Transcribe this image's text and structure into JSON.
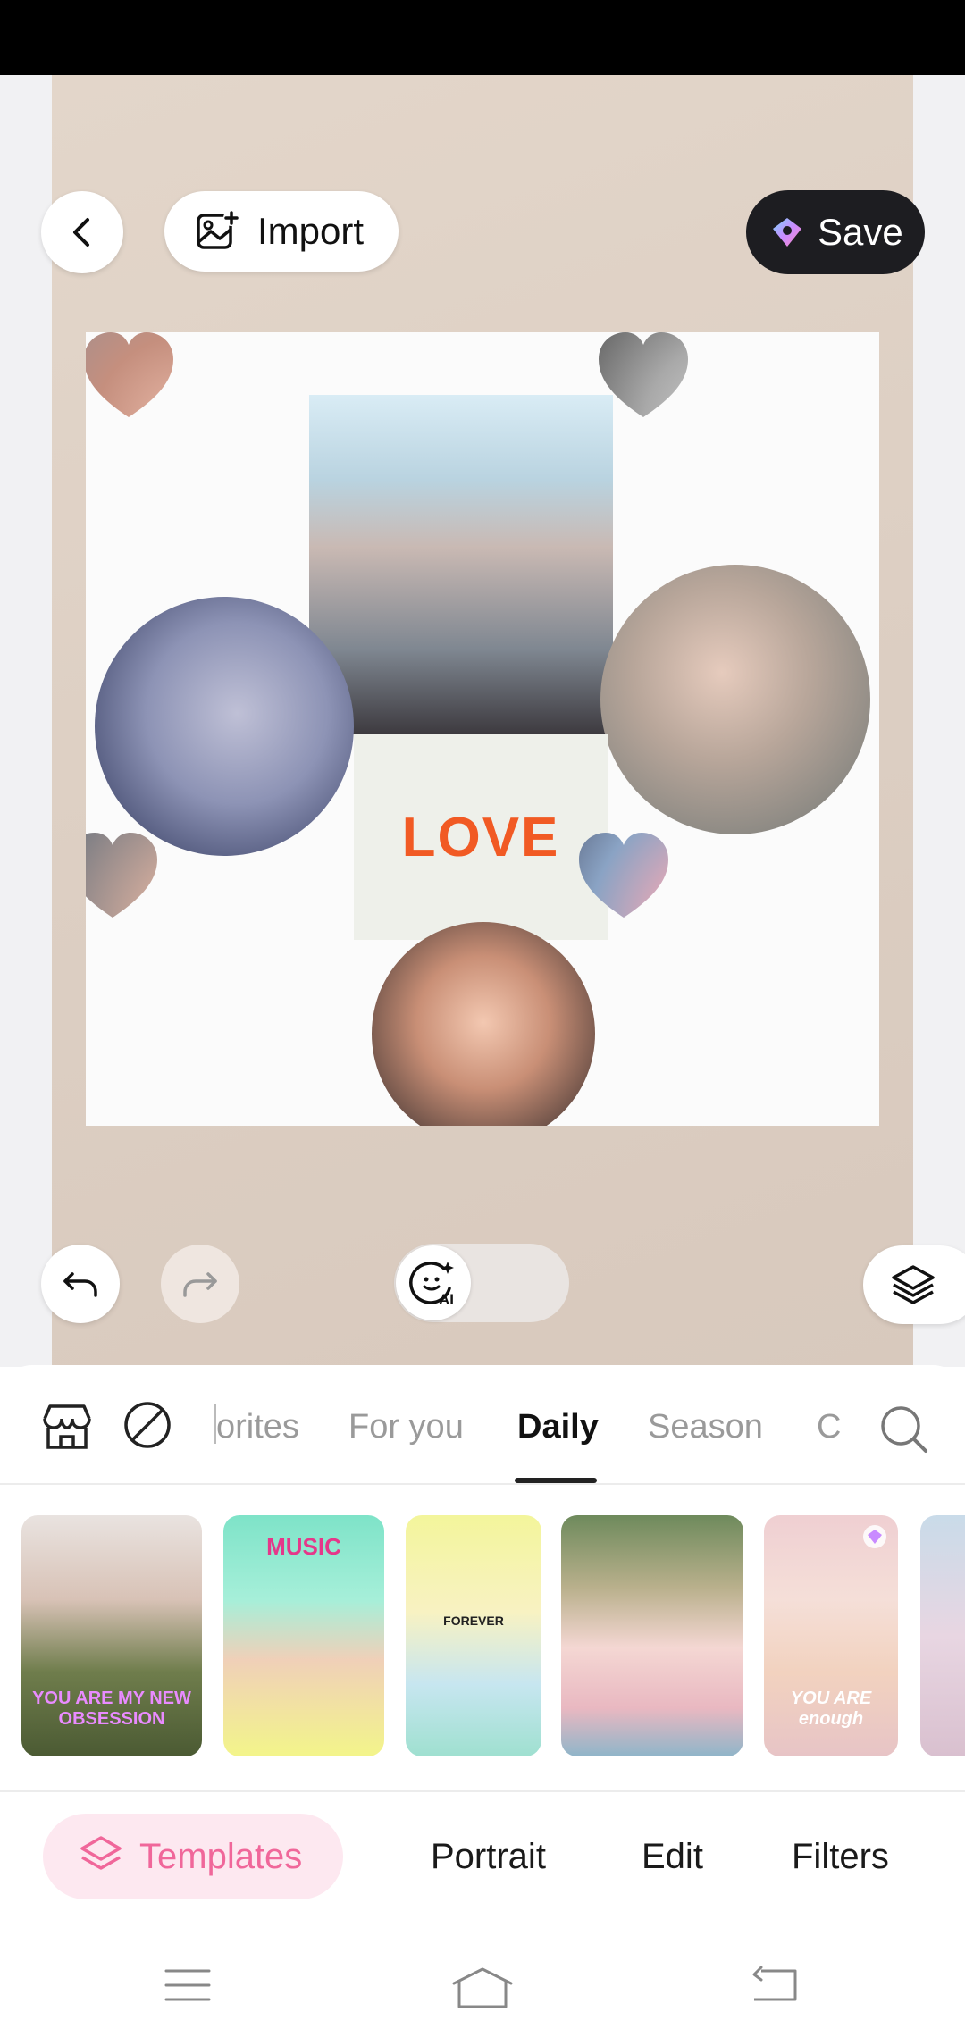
{
  "toolbar": {
    "import_label": "Import",
    "save_label": "Save"
  },
  "collage": {
    "love_text": "LOVE"
  },
  "categories": {
    "tabs": [
      "Favorites",
      "For you",
      "Daily",
      "Season",
      "C"
    ],
    "visible_tabs": [
      "orites",
      "For you",
      "Daily",
      "Season",
      "C"
    ],
    "active_tab": "Daily"
  },
  "templates": {
    "thumbs": [
      {
        "caption": "YOU ARE MY NEW OBSESSION"
      },
      {
        "caption": "MUSIC"
      },
      {
        "caption": "FOREVER"
      },
      {
        "caption": ""
      },
      {
        "caption": "YOU ARE enough"
      },
      {
        "caption": ""
      }
    ]
  },
  "bottom_nav": {
    "templates_label": "Templates",
    "portrait_label": "Portrait",
    "edit_label": "Edit",
    "filters_label": "Filters"
  },
  "colors": {
    "accent_pink": "#f0679a",
    "love_orange": "#f15a24",
    "save_bg": "#1d1d21"
  }
}
